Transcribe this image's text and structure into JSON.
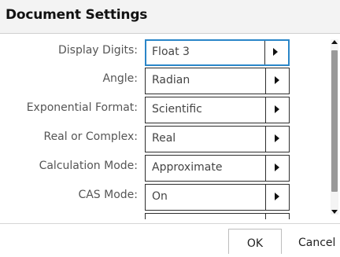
{
  "dialog": {
    "title": "Document Settings",
    "settings": [
      {
        "label": "Display Digits:",
        "value": "Float 3"
      },
      {
        "label": "Angle:",
        "value": "Radian"
      },
      {
        "label": "Exponential Format:",
        "value": "Scientific"
      },
      {
        "label": "Real or Complex:",
        "value": "Real"
      },
      {
        "label": "Calculation Mode:",
        "value": "Approximate"
      },
      {
        "label": "CAS Mode:",
        "value": "On"
      }
    ],
    "buttons": {
      "ok": "OK",
      "cancel": "Cancel"
    },
    "colors": {
      "focus_border": "#2a86c8",
      "title_bar": "#f3f3f3"
    },
    "icons": {
      "dropdown": "triangle-right-icon",
      "scroll_up": "triangle-up-icon",
      "scroll_down": "triangle-down-icon"
    }
  }
}
